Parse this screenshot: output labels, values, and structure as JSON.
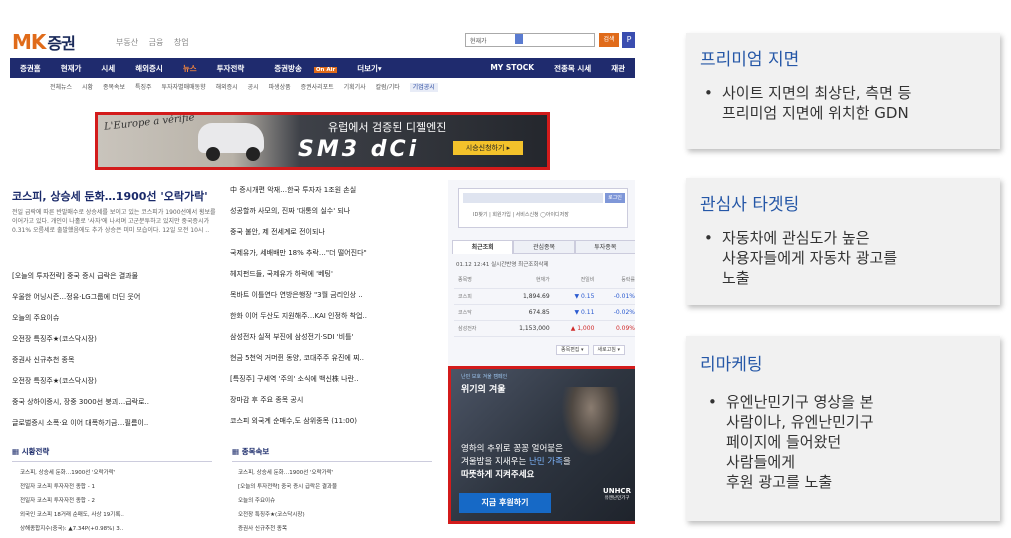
{
  "site": {
    "logo_mk": "MK",
    "logo_stock": "증권",
    "top_links": [
      "부동산",
      "금융",
      "창업"
    ],
    "search_select": "현재가",
    "search_button": "검색",
    "search_icon_glyph": "P",
    "gnb": [
      "증권홈",
      "현재가",
      "시세",
      "해외증시",
      "뉴스",
      "투자전략",
      "증권방송",
      "더보기▾"
    ],
    "gnb_active": "뉴스",
    "gnb_onair": "On Air",
    "gnb_right": [
      "MY STOCK",
      "전종목 시세",
      "재관"
    ],
    "subnav": [
      "전체뉴스",
      "시황",
      "종목속보",
      "특징주",
      "투자자별매매동향",
      "해외증시",
      "공시",
      "파생상품",
      "증권사리포트",
      "기획기사",
      "칼럼/기타"
    ],
    "subnav_highlight": "기업공시"
  },
  "banner": {
    "europe_text": "L'Europe a vérifié",
    "headline": "유럽에서 검증된 디젤엔진",
    "model": "SM3 dCi",
    "cta": "시승신청하기 ▸"
  },
  "news": {
    "headline": "코스피, 상승세 둔화…1900선 '오락가락'",
    "lead": "전일 급락에 따른 반발매수로 상승세를 보이고 있는 코스피가 1900선에서 횡보를 이어가고 있다. 개인이 나홀로 '사자'에 나서며 고군분투하고 있지만 중국증시가 0.31% 오름세로 출발했음에도 추가 상승은 미미 모습이다. 12일 오전 10시 ..",
    "list_a": [
      "[오늘의 투자전략] 중국 증시 급락은 결과물",
      "우울한 어닝시즌…정유·LG그룹에 더딘 웃어",
      "오늘의 주요이슈",
      "오전장 특징주★(코스닥시장)",
      "증권사 신규추천 종목",
      "오전장 특징주★(코스닥시장)",
      "중국 상하이증시, 장중 3000선 붕괴…급락로..",
      "글로벌증시 소폭·요 이어 대폭하기금…필름이.."
    ],
    "list_b": [
      "中 증시개편 악재…한국 투자자 1조원 손실",
      "성공할까 사모의, 진짜 '대통의 실수' 되나",
      "중국 불안, 제 전세계로 전이되나",
      "국제유가, 세배배만 18% 추락…\"더 떨어진다\"",
      "헤지펀드들, 국제유가 하락에 '베팅'",
      "목바트 이틀연다 연방은행장 \"3월 금리인상 ..",
      "한화 이어 두산도 지원해주…KAI 인정하 착업..",
      "삼성전자 실적 부진에 삼성전기·SDI '비틀'",
      "현금 5천억 거머쥔 동양, 코대주주 유진에 찌..",
      "[특징주] 구세역 '주의' 소식에 백신株 나란..",
      "장마감 후 주요 종목 공시",
      "코스피 외국계 순매수,도 삼위종목 (11:00)"
    ]
  },
  "section_a": {
    "title": "시황전략",
    "items": [
      "코스피, 상승세 둔화…1900선 '오락가락'",
      "전일자 코스피 투자자전 종합 - 1",
      "전일자 코스피 투자자전 종합 - 2",
      "외국인 코스피 18거래 순매도, 사상 19기록..",
      "상해종합지수(중국): ▲7.34P(+0.98%) 3.."
    ]
  },
  "section_b": {
    "title": "종목속보",
    "items": [
      "코스피, 상승세 둔화…1900선 '오락가락'",
      "[오늘의 투자전략] 중국 증시 급락은 결과물",
      "오늘의 주요이슈",
      "오전장 특징주★(코스닥시장)",
      "증권사 신규추천 종목"
    ]
  },
  "market": {
    "login_button": "로그인",
    "login_links": "ID찾기  |  회원가입  |  서비스신청  ◯아이디저장",
    "tabs": [
      "최근조회",
      "관심종목",
      "투자종목"
    ],
    "time": "01.12 12:41   실시간반영   최근조회삭제",
    "headers": [
      "종목명",
      "현재가",
      "전일비",
      "등락률"
    ],
    "rows": [
      {
        "name": "코스피",
        "price": "1,894.69",
        "change": "▼ 0.15",
        "rate": "-0.01%",
        "dir": "down"
      },
      {
        "name": "코스닥",
        "price": "674.85",
        "change": "▼ 0.11",
        "rate": "-0.02%",
        "dir": "down"
      },
      {
        "name": "삼성전자",
        "price": "1,153,000",
        "change": "▲ 1,000",
        "rate": "0.09%",
        "dir": "up"
      }
    ],
    "btn1": "종목편집 ▾",
    "btn2": "새로고침 ▾"
  },
  "unhcr_ad": {
    "small": "난민 보호 겨울 캠페인",
    "crisis": "위기의 겨울",
    "body_1": "영하의 추위로 꽁꽁 얼어붙은",
    "body_2a": "겨울밤을 지새우는 ",
    "body_2b": "난민 가족",
    "body_2c": "을",
    "body_3": "따뜻하게 지켜주세요",
    "donate": "지금 후원하기",
    "logo": "UNHCR",
    "logo_sub": "유엔난민기구"
  },
  "panels": [
    {
      "title": "프리미엄 지면",
      "lines": [
        "사이트 지면의 최상단, 측면 등",
        "프리미엄 지면에 위치한 GDN"
      ]
    },
    {
      "title": "관심사 타겟팅",
      "lines": [
        "자동차에 관심도가 높은",
        "사용자들에게 자동차 광고를",
        "노출"
      ]
    },
    {
      "title": "리마케팅",
      "lines": [
        "유엔난민기구 영상을 본",
        "사람이나, 유엔난민기구",
        "페이지에 들어왔던",
        "사람들에게",
        "후원 광고를 노출"
      ]
    }
  ],
  "colors": {
    "highlight_border": "#d31b1b",
    "brand_orange": "#e06b1a",
    "nav_navy": "#1f2b6e",
    "panel_title": "#2557a7"
  }
}
